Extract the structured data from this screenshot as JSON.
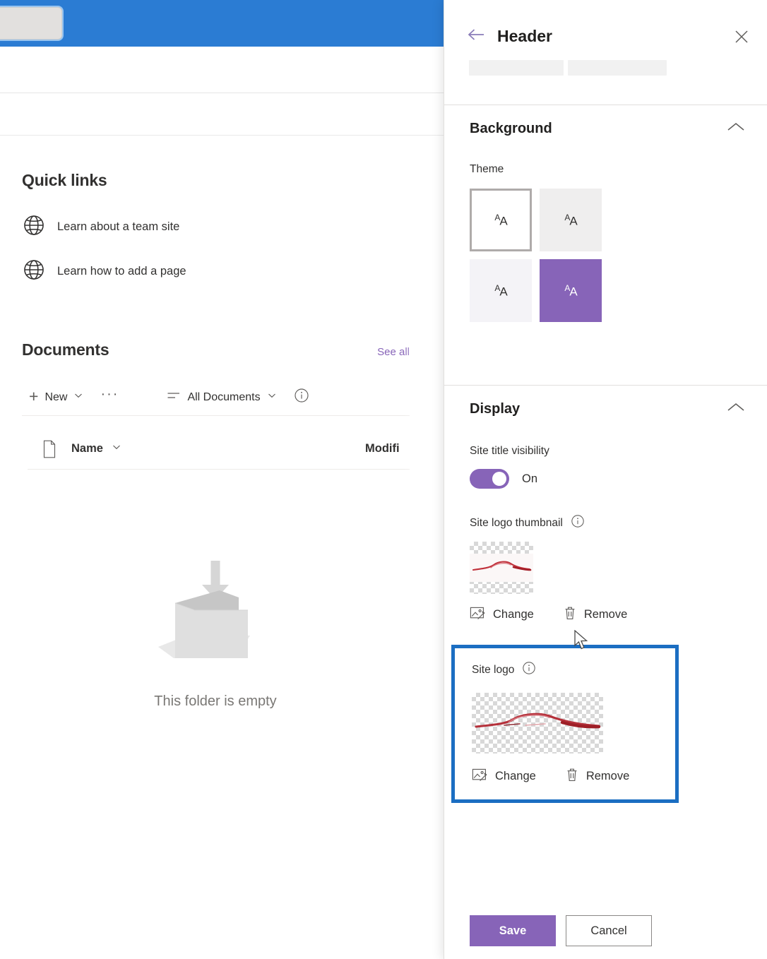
{
  "browser": {
    "tabstrip_color": "#2b7cd3",
    "tab_label": ""
  },
  "sp_page": {
    "quick_links": {
      "title": "Quick links",
      "items": [
        {
          "icon": "globe-icon",
          "label": "Learn about a team site"
        },
        {
          "icon": "globe-icon",
          "label": "Learn how to add a page"
        }
      ]
    },
    "documents": {
      "title": "Documents",
      "see_all_label": "See all",
      "see_all_color": "#8764b8",
      "command_bar": {
        "new_label": "New",
        "overflow_label": "···",
        "view_label": "All Documents",
        "info_icon": "info-circle-icon"
      },
      "columns": [
        {
          "key": "name",
          "label": "Name"
        },
        {
          "key": "modified",
          "label": "Modifi"
        }
      ],
      "rows": [],
      "empty_state_text": "This folder is empty"
    }
  },
  "panel": {
    "title": "Header",
    "back_icon": "arrow-left-icon",
    "close_icon": "close-icon",
    "sections": {
      "background": {
        "title": "Background",
        "collapse_icon": "chevron-up-icon",
        "theme_label": "Theme",
        "themes": [
          {
            "name": "light",
            "color": "#ffffff",
            "text_color": "#323130",
            "selected": true
          },
          {
            "name": "neutral",
            "color": "#efeeee",
            "text_color": "#323130",
            "selected": false
          },
          {
            "name": "soft",
            "color": "#f4f3f7",
            "text_color": "#323130",
            "selected": false
          },
          {
            "name": "strong",
            "color": "#8764b8",
            "text_color": "#ffffff",
            "selected": false
          }
        ],
        "swatch_glyph": "AA"
      },
      "display": {
        "title": "Display",
        "collapse_icon": "chevron-up-icon",
        "site_title_visibility": {
          "label": "Site title visibility",
          "state_label": "On",
          "enabled": true,
          "accent": "#8764b8"
        },
        "site_logo_thumbnail": {
          "label": "Site logo thumbnail",
          "info_icon": "info-circle-icon",
          "change_label": "Change",
          "change_icon": "image-edit-icon",
          "remove_label": "Remove",
          "remove_icon": "trash-icon"
        },
        "site_logo": {
          "label": "Site logo",
          "info_icon": "info-circle-icon",
          "change_label": "Change",
          "change_icon": "image-edit-icon",
          "remove_label": "Remove",
          "remove_icon": "trash-icon",
          "highlighted": true,
          "highlight_color": "#1b6ec2"
        }
      }
    },
    "footer": {
      "save_label": "Save",
      "save_color": "#8764b8",
      "cancel_label": "Cancel"
    }
  }
}
